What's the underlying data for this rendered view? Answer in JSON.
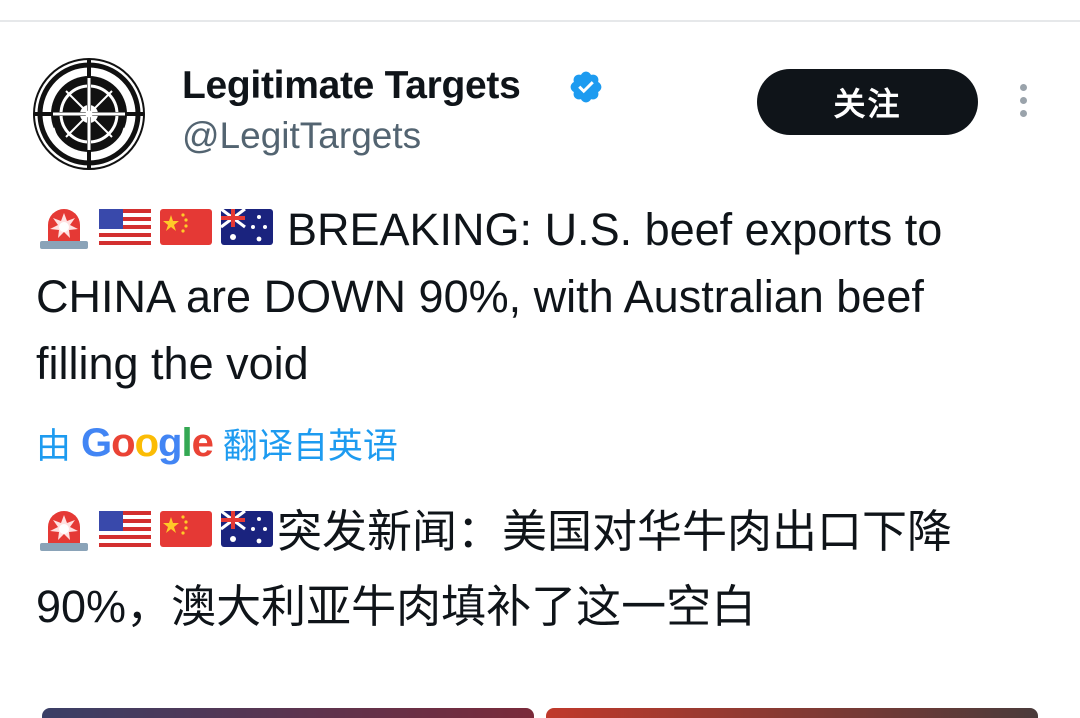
{
  "author": {
    "display_name": "Legitimate Targets",
    "handle": "@LegitTargets",
    "verified": true,
    "avatar_icon": "crosshair-wreath-emblem"
  },
  "actions": {
    "follow_label": "关注",
    "more_icon": "vertical-ellipsis-icon"
  },
  "tweet": {
    "emojis": [
      "police-light",
      "flag-us",
      "flag-cn",
      "flag-au"
    ],
    "text": "BREAKING: U.S. beef exports to CHINA are DOWN 90%, with Australian beef filling the void"
  },
  "translation": {
    "prefix": "由",
    "provider": "Google",
    "suffix": "翻译自英语",
    "text": "突发新闻：美国对华牛肉出口下降 90%，澳大利亚牛肉填补了这一空白"
  },
  "colors": {
    "link": "#1d9bf0",
    "button_bg": "#0f1419",
    "secondary_text": "#536471"
  }
}
